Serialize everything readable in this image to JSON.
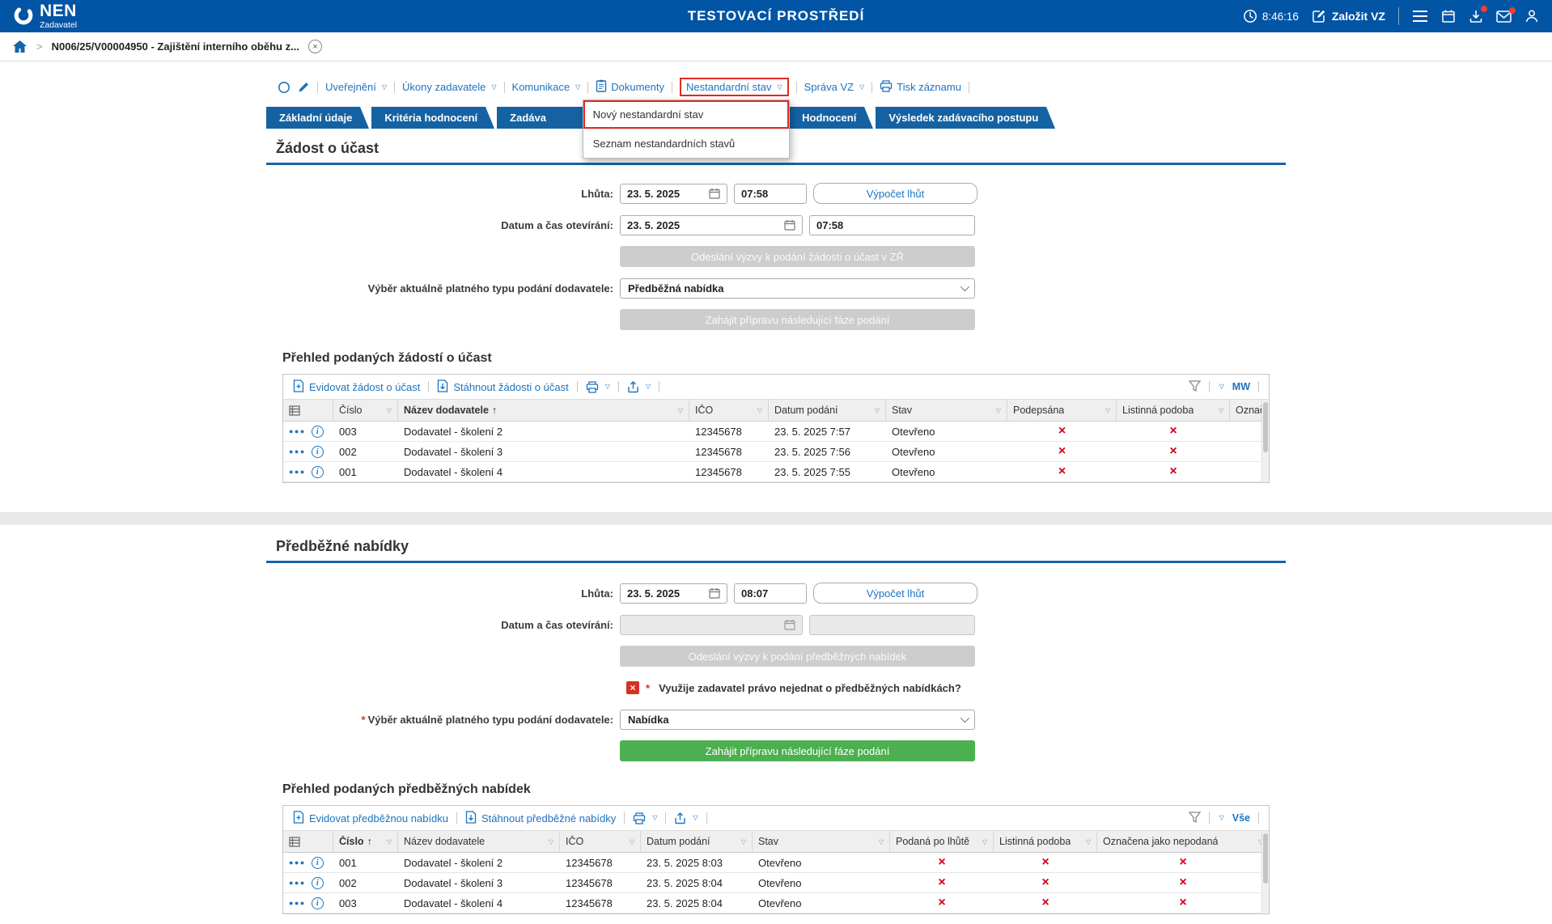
{
  "header": {
    "brand": "NEN",
    "subtitle": "Zadavatel",
    "title": "TESTOVACÍ PROSTŘEDÍ",
    "time": "8:46:16",
    "new_vz": "Založit VZ"
  },
  "breadcrumb": {
    "item": "N006/25/V00004950 - Zajištění interního oběhu z..."
  },
  "cmd": {
    "items": [
      "Uveřejnění",
      "Úkony zadavatele",
      "Komunikace",
      "Dokumenty",
      "Nestandardní stav",
      "Správa VZ",
      "Tisk záznamu"
    ]
  },
  "menu": {
    "items": [
      "Nový nestandardní stav",
      "Seznam nestandardních stavů"
    ]
  },
  "tabs": [
    "Základní údaje",
    "Kritéria hodnocení",
    "Zadáva",
    "Hodnocení",
    "Výsledek zadávacího postupu"
  ],
  "s1": {
    "title": "Žádost o účast",
    "lhuta_label": "Lhůta:",
    "lhuta_date": "23. 5. 2025",
    "lhuta_time": "07:58",
    "vypocet": "Výpočet lhůt",
    "otv_label": "Datum a čas otevírání:",
    "otv_date": "23. 5. 2025",
    "otv_time": "07:58",
    "odeslani": "Odeslání výzvy k podání žádosti o účast v ZŘ",
    "vyber_label": "Výběr aktuálně platného typu podání dodavatele:",
    "vyber_value": "Předběžná nabídka",
    "zahajit": "Zahájit přípravu následující fáze podání",
    "heading": "Přehled podaných žádostí o účast",
    "t": {
      "action1": "Evidovat žádost o účast",
      "action2": "Stáhnout žádosti o účast",
      "view": "MW",
      "cols": [
        "Číslo",
        "Název dodavatele",
        "IČO",
        "Datum podání",
        "Stav",
        "Podepsána",
        "Listinná podoba",
        "Označ"
      ],
      "rows": [
        {
          "num": "003",
          "name": "Dodavatel - školení 2",
          "ico": "12345678",
          "date": "23. 5. 2025 7:57",
          "status": "Otevřeno"
        },
        {
          "num": "002",
          "name": "Dodavatel - školení 3",
          "ico": "12345678",
          "date": "23. 5. 2025 7:56",
          "status": "Otevřeno"
        },
        {
          "num": "001",
          "name": "Dodavatel - školení 4",
          "ico": "12345678",
          "date": "23. 5. 2025 7:55",
          "status": "Otevřeno"
        }
      ]
    }
  },
  "s2": {
    "title": "Předběžné nabídky",
    "lhuta_label": "Lhůta:",
    "lhuta_date": "23. 5. 2025",
    "lhuta_time": "08:07",
    "vypocet": "Výpočet lhůt",
    "otv_label": "Datum a čas otevírání:",
    "odeslani": "Odeslání výzvy k podání předběžných nabídek",
    "req": "*",
    "question": "Využije zadavatel právo nejednat o předběžných nabídkách?",
    "vyber_label": "Výběr aktuálně platného typu podání dodavatele:",
    "vyber_value": "Nabídka",
    "zahajit": "Zahájit přípravu následující fáze podání",
    "heading": "Přehled podaných předběžných nabídek",
    "t": {
      "action1": "Evidovat předběžnou nabídku",
      "action2": "Stáhnout předběžné nabídky",
      "view": "Vše",
      "cols": [
        "Číslo",
        "Název dodavatele",
        "IČO",
        "Datum podání",
        "Stav",
        "Podaná po lhůtě",
        "Listinná podoba",
        "Označena jako nepodaná"
      ],
      "rows": [
        {
          "num": "001",
          "name": "Dodavatel - školení 2",
          "ico": "12345678",
          "date": "23. 5. 2025 8:03",
          "status": "Otevřeno"
        },
        {
          "num": "002",
          "name": "Dodavatel - školení 3",
          "ico": "12345678",
          "date": "23. 5. 2025 8:04",
          "status": "Otevřeno"
        },
        {
          "num": "003",
          "name": "Dodavatel - školení 4",
          "ico": "12345678",
          "date": "23. 5. 2025 8:04",
          "status": "Otevřeno"
        }
      ]
    }
  }
}
